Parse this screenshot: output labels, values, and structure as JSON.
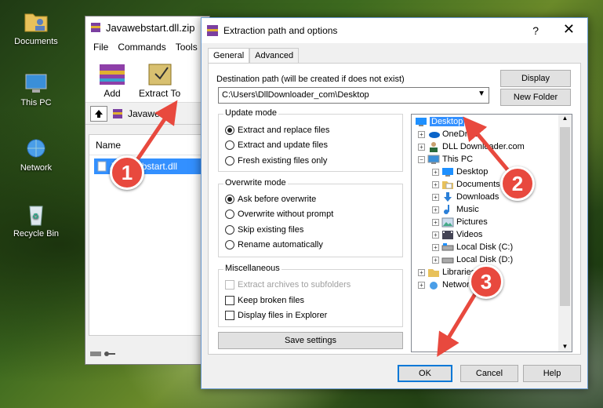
{
  "desktop": {
    "icons": [
      {
        "label": "Documents",
        "icon": "folder-user-icon"
      },
      {
        "label": "This PC",
        "icon": "computer-icon"
      },
      {
        "label": "Network",
        "icon": "network-icon"
      },
      {
        "label": "Recycle Bin",
        "icon": "recycle-bin-icon"
      }
    ]
  },
  "winrar": {
    "title": "Javawebstart.dll.zip",
    "menu": [
      "File",
      "Commands",
      "Tools"
    ],
    "toolbar": {
      "add": "Add",
      "extract": "Extract To"
    },
    "address": "Javawebst",
    "list_header": "Name",
    "file": "Javawebstart.dll"
  },
  "dialog": {
    "title": "Extraction path and options",
    "help": "?",
    "tabs": [
      "General",
      "Advanced"
    ],
    "dest_label": "Destination path (will be created if does not exist)",
    "dest_value": "C:\\Users\\DllDownloader_com\\Desktop",
    "display_btn": "Display",
    "new_folder_btn": "New Folder",
    "update_mode": {
      "title": "Update mode",
      "options": [
        "Extract and replace files",
        "Extract and update files",
        "Fresh existing files only"
      ],
      "selected": 0
    },
    "overwrite_mode": {
      "title": "Overwrite mode",
      "options": [
        "Ask before overwrite",
        "Overwrite without prompt",
        "Skip existing files",
        "Rename automatically"
      ],
      "selected": 0
    },
    "misc": {
      "title": "Miscellaneous",
      "options": [
        "Extract archives to subfolders",
        "Keep broken files",
        "Display files in Explorer"
      ]
    },
    "save_settings": "Save settings",
    "tree": [
      {
        "label": "Desktop",
        "icon": "desktop-icon",
        "selected": true
      },
      {
        "label": "OneDrive",
        "icon": "onedrive-icon"
      },
      {
        "label": "DLL Downloader.com",
        "icon": "user-icon"
      },
      {
        "label": "This PC",
        "icon": "computer-icon"
      },
      {
        "label": "Desktop",
        "icon": "desktop-icon"
      },
      {
        "label": "Documents",
        "icon": "documents-icon"
      },
      {
        "label": "Downloads",
        "icon": "downloads-icon"
      },
      {
        "label": "Music",
        "icon": "music-icon"
      },
      {
        "label": "Pictures",
        "icon": "pictures-icon"
      },
      {
        "label": "Videos",
        "icon": "videos-icon"
      },
      {
        "label": "Local Disk (C:)",
        "icon": "disk-icon"
      },
      {
        "label": "Local Disk (D:)",
        "icon": "disk-icon"
      },
      {
        "label": "Libraries",
        "icon": "libraries-icon"
      },
      {
        "label": "Network",
        "icon": "network-icon"
      }
    ],
    "ok": "OK",
    "cancel": "Cancel",
    "help_btn": "Help"
  },
  "callouts": [
    "1",
    "2",
    "3"
  ],
  "colors": {
    "callout": "#e8493e",
    "selection": "#3390ff"
  }
}
